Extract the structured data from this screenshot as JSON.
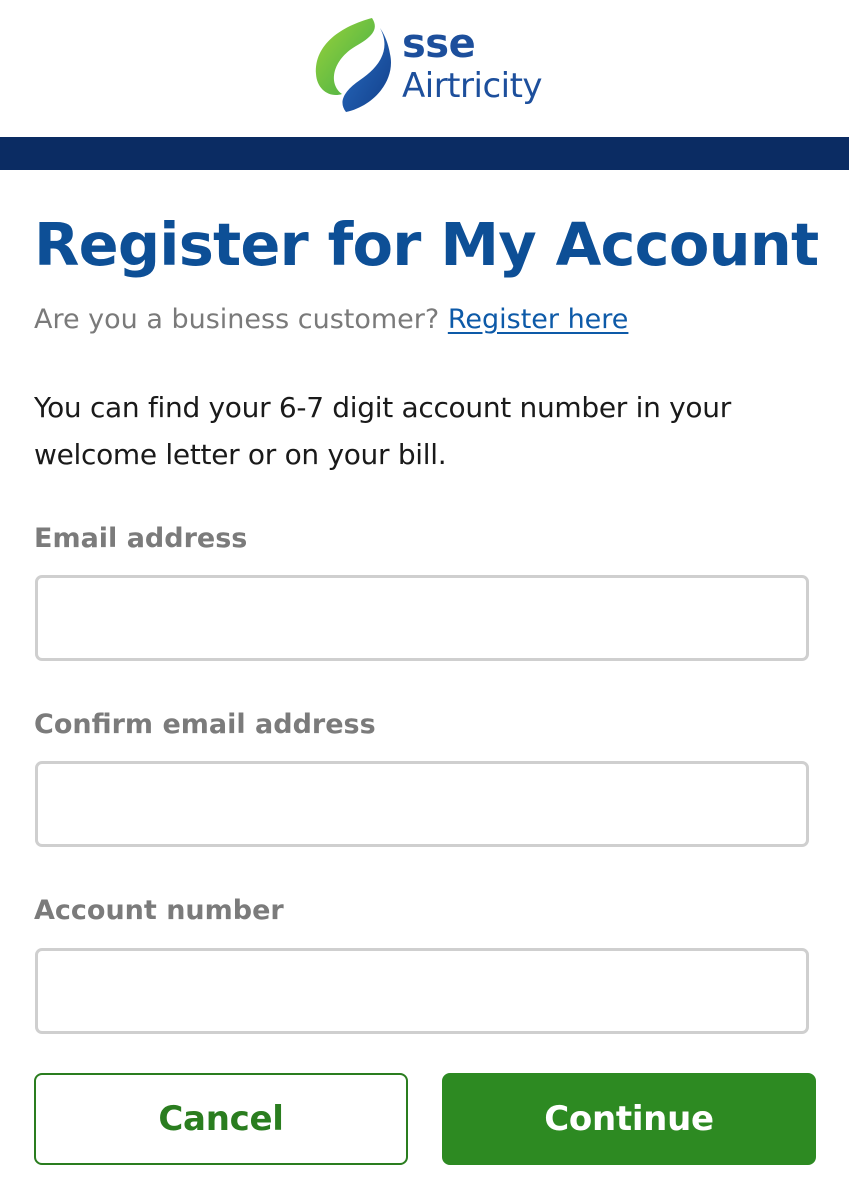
{
  "brand": {
    "name_line1": "sse",
    "name_line2": "Airtricity",
    "logo_icon": "sse-swirl-logo-icon",
    "primary_color": "#1d4f9c",
    "nav_bar_color": "#0b2c63",
    "accent_green": "#2d8a22"
  },
  "page": {
    "title": "Register for My Account",
    "business_prompt": "Are you a business customer?",
    "business_link": "Register here",
    "intro_text": "You can find your 6-7 digit account number in your welcome letter or on your bill."
  },
  "form": {
    "email_label": "Email address",
    "email_value": "",
    "confirm_email_label": "Confirm email address",
    "confirm_email_value": "",
    "account_number_label": "Account number",
    "account_number_value": ""
  },
  "actions": {
    "cancel_label": "Cancel",
    "continue_label": "Continue"
  }
}
